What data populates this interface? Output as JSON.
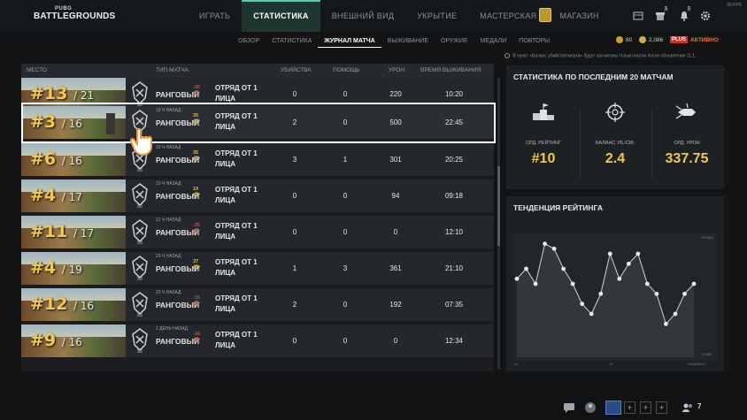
{
  "app": {
    "logo_line1": "PUBG",
    "logo_line2": "BATTLEGROUNDS",
    "fps": "60 FPS"
  },
  "main_nav": [
    {
      "label": "ИГРАТЬ",
      "active": false
    },
    {
      "label": "СТАТИСТИКА",
      "active": true
    },
    {
      "label": "ВНЕШНИЙ ВИД",
      "active": false
    },
    {
      "label": "УКРЫТИЕ",
      "active": false
    },
    {
      "label": "МАСТЕРСКАЯ",
      "active": false
    },
    {
      "label": "МАГАЗИН",
      "active": false
    }
  ],
  "top_icons": {
    "gift_count": "1",
    "notification_count": "1"
  },
  "sub_nav": [
    {
      "label": "ОБЗОР",
      "active": false
    },
    {
      "label": "СТАТИСТИКА",
      "active": false
    },
    {
      "label": "ЖУРНАЛ МАТЧА",
      "active": true
    },
    {
      "label": "ВЫЖИВАНИЕ",
      "active": false
    },
    {
      "label": "ОРУЖИЕ",
      "active": false
    },
    {
      "label": "МЕДАЛИ",
      "active": false
    },
    {
      "label": "ПОВТОРЫ",
      "active": false
    }
  ],
  "currency": {
    "bp": "80",
    "gcoin": "2,086",
    "plus_badge": "PLUS",
    "plus_status": "АКТИВНО"
  },
  "table": {
    "headers": {
      "place": "МЕСТО",
      "match_type": "ТИП МАТЧА",
      "kills": "УБИЙСТВА",
      "assists": "ПОМОЩЬ",
      "damage": "УРОН",
      "survival": "ВРЕМЯ ВЫЖИВАНИЯ"
    },
    "rows": [
      {
        "place": "#13",
        "total": "/ 21",
        "ago": "",
        "mode": "РАНГОВЫЙ",
        "rp": "-25",
        "rp_unit": "ОР",
        "rp_sign": "neg",
        "squad_l1": "ОТРЯД ОТ 1",
        "squad_l2": "ЛИЦА",
        "kills": "0",
        "assists": "0",
        "damage": "220",
        "time": "10:20"
      },
      {
        "place": "#3",
        "total": "/ 16",
        "ago": "19 Ч НАЗАД",
        "mode": "РАНГОВЫЙ",
        "rp": "35",
        "rp_unit": "ОР",
        "rp_sign": "pos",
        "squad_l1": "ОТРЯД ОТ 1",
        "squad_l2": "ЛИЦА",
        "kills": "2",
        "assists": "0",
        "damage": "500",
        "time": "22:45"
      },
      {
        "place": "#6",
        "total": "/ 16",
        "ago": "19 Ч НАЗАД",
        "mode": "РАНГОВЫЙ",
        "rp": "35",
        "rp_unit": "ОР",
        "rp_sign": "pos",
        "squad_l1": "ОТРЯД ОТ 1",
        "squad_l2": "ЛИЦА",
        "kills": "3",
        "assists": "1",
        "damage": "301",
        "time": "20:25"
      },
      {
        "place": "#4",
        "total": "/ 17",
        "ago": "20 Ч НАЗАД",
        "mode": "РАНГОВЫЙ",
        "rp": "19",
        "rp_unit": "ОР",
        "rp_sign": "pos",
        "squad_l1": "ОТРЯД ОТ 1",
        "squad_l2": "ЛИЦА",
        "kills": "0",
        "assists": "0",
        "damage": "94",
        "time": "09:18"
      },
      {
        "place": "#11",
        "total": "/ 17",
        "ago": "21 Ч НАЗАД",
        "mode": "РАНГОВЫЙ",
        "rp": "-25",
        "rp_unit": "ОР",
        "rp_sign": "neg",
        "squad_l1": "ОТРЯД ОТ 1",
        "squad_l2": "ЛИЦА",
        "kills": "0",
        "assists": "0",
        "damage": "0",
        "time": "12:10"
      },
      {
        "place": "#4",
        "total": "/ 19",
        "ago": "23 Ч НАЗАД",
        "mode": "РАНГОВЫЙ",
        "rp": "37",
        "rp_unit": "ОР",
        "rp_sign": "pos",
        "squad_l1": "ОТРЯД ОТ 1",
        "squad_l2": "ЛИЦА",
        "kills": "1",
        "assists": "3",
        "damage": "361",
        "time": "21:10"
      },
      {
        "place": "#12",
        "total": "/ 16",
        "ago": "23 Ч НАЗАД",
        "mode": "РАНГОВЫЙ",
        "rp": "-15",
        "rp_unit": "ОР",
        "rp_sign": "neg",
        "squad_l1": "ОТРЯД ОТ 1",
        "squad_l2": "ЛИЦА",
        "kills": "2",
        "assists": "0",
        "damage": "192",
        "time": "07:35"
      },
      {
        "place": "#9",
        "total": "/ 16",
        "ago": "1 ДЕНЬ НАЗАД",
        "mode": "РАНГОВЫЙ",
        "rp": "-18",
        "rp_unit": "ОР",
        "rp_sign": "neg",
        "squad_l1": "ОТРЯД ОТ 1",
        "squad_l2": "ЛИЦА",
        "kills": "0",
        "assists": "0",
        "damage": "0",
        "time": "12:34"
      }
    ]
  },
  "right_panel": {
    "note": "В пункт «Баланс убийств/смерти» будут засчитаны только матчи после обновления 11.1.",
    "stats_title": "СТАТИСТИКА ПО ПОСЛЕДНИМ 20 МАТЧАМ",
    "stats": [
      {
        "icon": "podium-icon",
        "label": "СРД. РЕЙТИНГ",
        "value": "#10"
      },
      {
        "icon": "crosshair-icon",
        "label": "БАЛАНС УБ./СМ.",
        "value": "2.4"
      },
      {
        "icon": "bullet-burst-icon",
        "label": "СРД. УРОН",
        "value": "337.75"
      }
    ],
    "trend_title": "ТЕНДЕНЦИЯ РЕЙТИНГА",
    "trend_axis_top": "ЛУЧШЕ",
    "trend_axis_bottom": "ХУЖЕ",
    "trend_x_left": "20",
    "trend_x_mid": "10",
    "trend_x_right": "НЕДАВНО"
  },
  "chart_data": {
    "type": "line",
    "title": "ТЕНДЕНЦИЯ РЕЙТИНГА",
    "x": [
      1,
      2,
      3,
      4,
      5,
      6,
      7,
      8,
      9,
      10,
      11,
      12,
      13,
      14,
      15,
      16,
      17,
      18,
      19,
      20
    ],
    "y": [
      8,
      6,
      9,
      1,
      2,
      6,
      9,
      13,
      15,
      11,
      3,
      8,
      5,
      3,
      9,
      11,
      17,
      15,
      11,
      9
    ],
    "ylim": [
      18,
      0
    ],
    "note_y": "placement rank (lower is better, top of chart = better)"
  },
  "bottom_bar": {
    "friends_count": "7",
    "party_slots": [
      "+",
      "+",
      "+"
    ]
  },
  "colors": {
    "accent_gold": "#f2c94c",
    "accent_teal": "#4fd0b0",
    "negative_red": "#e2463a"
  }
}
